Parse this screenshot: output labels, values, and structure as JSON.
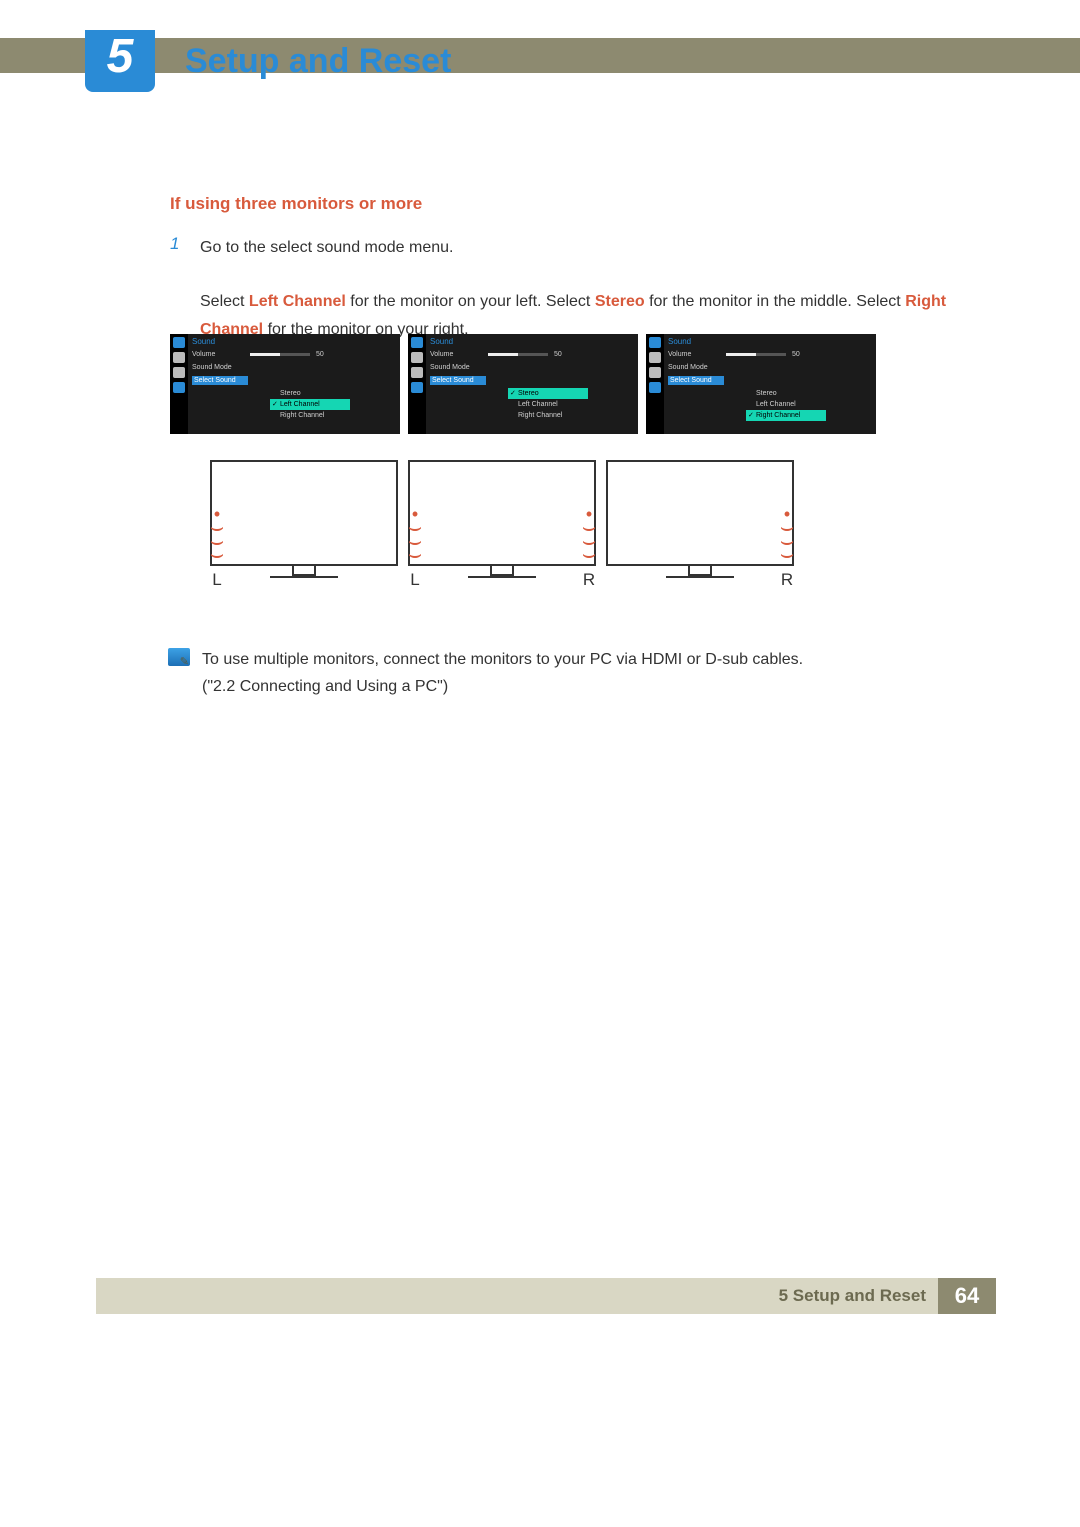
{
  "chapter": {
    "number": "5",
    "title": "Setup and Reset"
  },
  "section": {
    "subhead": "If using three monitors or more"
  },
  "step1": {
    "num": "1",
    "line1": "Go to the select sound mode menu.",
    "line2_a": "Select ",
    "line2_b": "Left Channel",
    "line2_c": " for the monitor on your left. Select ",
    "line2_d": "Stereo",
    "line2_e": " for the monitor in the middle. Select ",
    "line2_f": "Right Channel",
    "line2_g": " for the monitor on your right."
  },
  "osd": {
    "title": "Sound",
    "volume_label": "Volume",
    "volume_value": "50",
    "soundmode_label": "Sound Mode",
    "select_label": "Select Sound",
    "opt_stereo": "Stereo",
    "opt_left": "Left Channel",
    "opt_right": "Right Channel"
  },
  "labels": {
    "L": "L",
    "R": "R"
  },
  "note": {
    "line1": "To use multiple monitors, connect the monitors to your PC via HDMI or D-sub cables.",
    "line2": "(\"2.2 Connecting and Using a PC\")"
  },
  "footer": {
    "title": "5 Setup and Reset",
    "page": "64"
  }
}
